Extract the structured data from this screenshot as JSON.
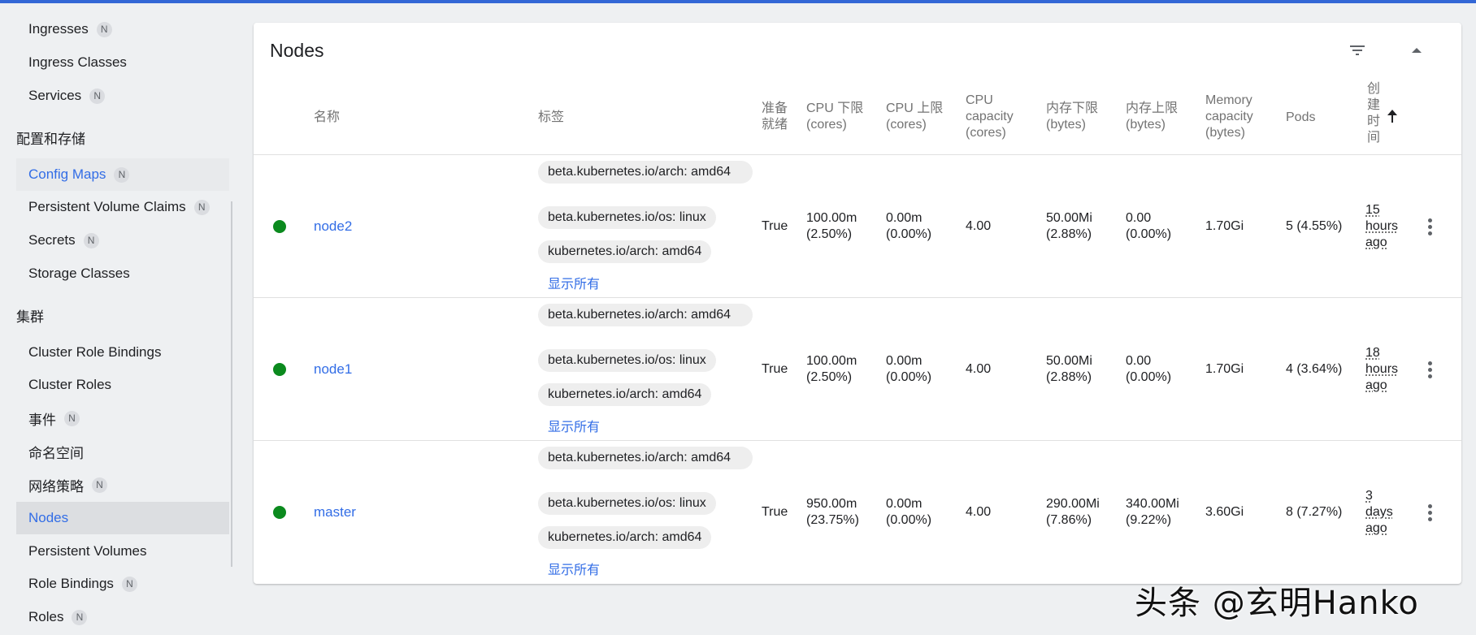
{
  "sidebar": {
    "items_top": [
      {
        "label": "Ingresses",
        "badge": "N"
      },
      {
        "label": "Ingress Classes",
        "badge": ""
      },
      {
        "label": "Services",
        "badge": "N"
      }
    ],
    "section_config": "配置和存储",
    "items_config": [
      {
        "label": "Config Maps",
        "badge": "N"
      },
      {
        "label": "Persistent Volume Claims",
        "badge": "N"
      },
      {
        "label": "Secrets",
        "badge": "N"
      },
      {
        "label": "Storage Classes",
        "badge": ""
      }
    ],
    "section_cluster": "集群",
    "items_cluster": [
      {
        "label": "Cluster Role Bindings",
        "badge": ""
      },
      {
        "label": "Cluster Roles",
        "badge": ""
      },
      {
        "label": "事件",
        "badge": "N"
      },
      {
        "label": "命名空间",
        "badge": ""
      },
      {
        "label": "网络策略",
        "badge": "N"
      },
      {
        "label": "Nodes",
        "badge": ""
      },
      {
        "label": "Persistent Volumes",
        "badge": ""
      },
      {
        "label": "Role Bindings",
        "badge": "N"
      },
      {
        "label": "Roles",
        "badge": "N"
      }
    ]
  },
  "card": {
    "title": "Nodes"
  },
  "table": {
    "headers": {
      "name": "名称",
      "labels": "标签",
      "ready": [
        "准备",
        "就绪"
      ],
      "cpu_req": [
        "CPU 下限",
        "(cores)"
      ],
      "cpu_lim": [
        "CPU 上限",
        "(cores)"
      ],
      "cpu_cap": [
        "CPU",
        "capacity",
        "(cores)"
      ],
      "mem_req": [
        "内存下限",
        "(bytes)"
      ],
      "mem_lim": [
        "内存上限",
        "(bytes)"
      ],
      "mem_cap": [
        "Memory",
        "capacity",
        "(bytes)"
      ],
      "pods": "Pods",
      "created": [
        "创",
        "建",
        "时",
        "间"
      ]
    },
    "rows": [
      {
        "name": "node2",
        "labels": [
          "beta.kubernetes.io/arch: amd64",
          "beta.kubernetes.io/os: linux",
          "kubernetes.io/arch: amd64"
        ],
        "show_all": "显示所有",
        "ready": "True",
        "cpu_req": [
          "100.00m",
          "(2.50%)"
        ],
        "cpu_lim": [
          "0.00m",
          "(0.00%)"
        ],
        "cpu_cap": "4.00",
        "mem_req": [
          "50.00Mi",
          "(2.88%)"
        ],
        "mem_lim": [
          "0.00",
          "(0.00%)"
        ],
        "mem_cap": "1.70Gi",
        "pods": "5 (4.55%)",
        "age": [
          "15",
          "hours",
          "ago"
        ]
      },
      {
        "name": "node1",
        "labels": [
          "beta.kubernetes.io/arch: amd64",
          "beta.kubernetes.io/os: linux",
          "kubernetes.io/arch: amd64"
        ],
        "show_all": "显示所有",
        "ready": "True",
        "cpu_req": [
          "100.00m",
          "(2.50%)"
        ],
        "cpu_lim": [
          "0.00m",
          "(0.00%)"
        ],
        "cpu_cap": "4.00",
        "mem_req": [
          "50.00Mi",
          "(2.88%)"
        ],
        "mem_lim": [
          "0.00",
          "(0.00%)"
        ],
        "mem_cap": "1.70Gi",
        "pods": "4 (3.64%)",
        "age": [
          "18",
          "hours",
          "ago"
        ]
      },
      {
        "name": "master",
        "labels": [
          "beta.kubernetes.io/arch: amd64",
          "beta.kubernetes.io/os: linux",
          "kubernetes.io/arch: amd64"
        ],
        "show_all": "显示所有",
        "ready": "True",
        "cpu_req": [
          "950.00m",
          "(23.75%)"
        ],
        "cpu_lim": [
          "0.00m",
          "(0.00%)"
        ],
        "cpu_cap": "4.00",
        "mem_req": [
          "290.00Mi",
          "(7.86%)"
        ],
        "mem_lim": [
          "340.00Mi",
          "(9.22%)"
        ],
        "mem_cap": "3.60Gi",
        "pods": "8 (7.27%)",
        "age": [
          "3",
          "days",
          "ago"
        ]
      }
    ]
  },
  "icons": {
    "filter": "filter-icon",
    "collapse": "collapse-up-icon",
    "sort": "sort-arrow-up-icon",
    "more": "more-vert-icon",
    "status": "status-ready-icon"
  },
  "colors": {
    "accent": "#326de6",
    "top_bar": "#3367d6",
    "status_ready": "#0b8a1e"
  },
  "watermark": "头条 @玄明Hanko"
}
